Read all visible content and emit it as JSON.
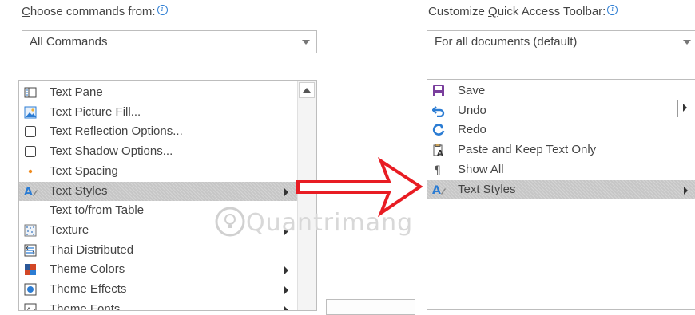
{
  "left_panel": {
    "label": "Choose commands from:",
    "label_underlined": "C",
    "label_rest": "hoose commands from:",
    "dropdown_value": "All Commands",
    "items": [
      {
        "label": "Text Pane",
        "icon": "text-pane-icon",
        "submenu": false,
        "selected": false
      },
      {
        "label": "Text Picture Fill...",
        "icon": "picture-fill-icon",
        "submenu": false,
        "selected": false
      },
      {
        "label": "Text Reflection Options...",
        "icon": "checkbox-icon",
        "submenu": false,
        "selected": false
      },
      {
        "label": "Text Shadow Options...",
        "icon": "checkbox-icon",
        "submenu": false,
        "selected": false
      },
      {
        "label": "Text Spacing",
        "icon": "bullet-dot-icon",
        "submenu": false,
        "selected": false
      },
      {
        "label": "Text Styles",
        "icon": "text-styles-icon",
        "submenu": true,
        "selected": true
      },
      {
        "label": "Text to/from Table",
        "icon": "",
        "submenu": false,
        "selected": false
      },
      {
        "label": "Texture",
        "icon": "texture-icon",
        "submenu": true,
        "selected": false
      },
      {
        "label": "Thai Distributed",
        "icon": "thai-distributed-icon",
        "submenu": false,
        "selected": false
      },
      {
        "label": "Theme Colors",
        "icon": "theme-colors-icon",
        "submenu": true,
        "selected": false
      },
      {
        "label": "Theme Effects",
        "icon": "theme-effects-icon",
        "submenu": true,
        "selected": false
      },
      {
        "label": "Theme Fonts",
        "icon": "theme-fonts-icon",
        "submenu": true,
        "selected": false
      }
    ]
  },
  "right_panel": {
    "label_part1": "Customize ",
    "label_underlined": "Q",
    "label_part2": "uick Access Toolbar:",
    "dropdown_value": "For all documents (default)",
    "items": [
      {
        "label": "Save",
        "icon": "save-icon",
        "submenu": false,
        "selected": false
      },
      {
        "label": "Undo",
        "icon": "undo-icon",
        "submenu": false,
        "selected": false
      },
      {
        "label": "Redo",
        "icon": "redo-icon",
        "submenu": false,
        "selected": false
      },
      {
        "label": "Paste and Keep Text Only",
        "icon": "paste-text-only-icon",
        "submenu": false,
        "selected": false
      },
      {
        "label": "Show All",
        "icon": "pilcrow-icon",
        "submenu": false,
        "selected": false
      },
      {
        "label": "Text Styles",
        "icon": "text-styles-icon",
        "submenu": true,
        "selected": true
      }
    ]
  },
  "watermark": "Quantrimang",
  "colors": {
    "arrow": "#e81c23",
    "selection": "#c6c6c6",
    "accent": "#2b7cd3",
    "save": "#7a3e9d"
  }
}
